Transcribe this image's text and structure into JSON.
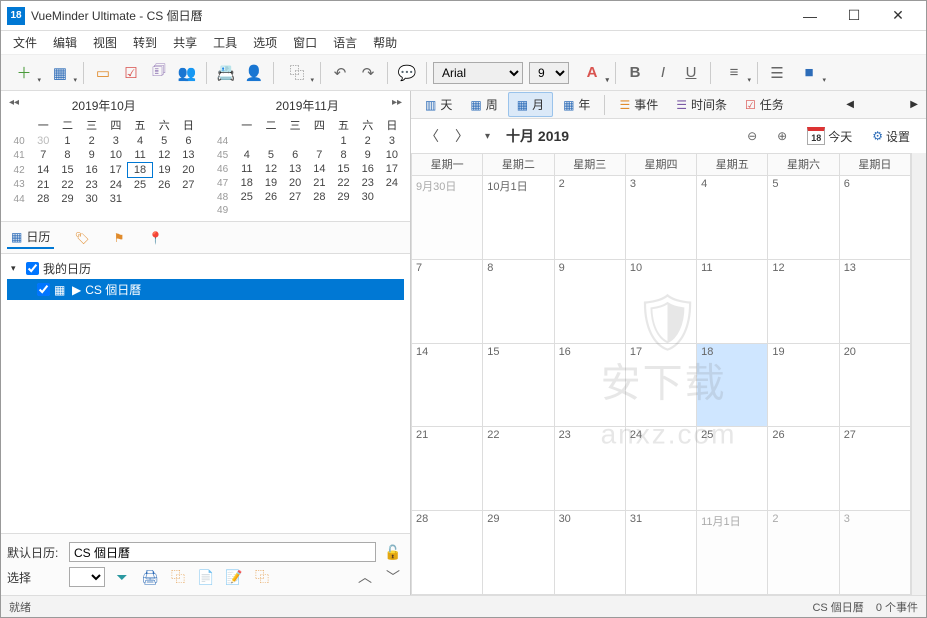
{
  "window": {
    "icon_text": "18",
    "title": "VueMinder Ultimate - CS 個日曆"
  },
  "menu": [
    "文件",
    "编辑",
    "视图",
    "转到",
    "共享",
    "工具",
    "选项",
    "窗口",
    "语言",
    "帮助"
  ],
  "toolbar": {
    "font_name": "Arial",
    "font_size": "9"
  },
  "mini_cals": [
    {
      "title": "2019年10月",
      "dow": [
        "",
        "一",
        "二",
        "三",
        "四",
        "五",
        "六",
        "日"
      ],
      "rows": [
        [
          "40",
          "30",
          "1",
          "2",
          "3",
          "4",
          "5",
          "6"
        ],
        [
          "41",
          "7",
          "8",
          "9",
          "10",
          "11",
          "12",
          "13"
        ],
        [
          "42",
          "14",
          "15",
          "16",
          "17",
          "18",
          "19",
          "20"
        ],
        [
          "43",
          "21",
          "22",
          "23",
          "24",
          "25",
          "26",
          "27"
        ],
        [
          "44",
          "28",
          "29",
          "30",
          "31",
          "",
          "",
          ""
        ]
      ],
      "today_col": 5,
      "today_row": 2,
      "dim_first": true
    },
    {
      "title": "2019年11月",
      "dow": [
        "",
        "一",
        "二",
        "三",
        "四",
        "五",
        "六",
        "日"
      ],
      "rows": [
        [
          "44",
          "",
          "",
          "",
          "",
          "1",
          "2",
          "3"
        ],
        [
          "45",
          "4",
          "5",
          "6",
          "7",
          "8",
          "9",
          "10"
        ],
        [
          "46",
          "11",
          "12",
          "13",
          "14",
          "15",
          "16",
          "17"
        ],
        [
          "47",
          "18",
          "19",
          "20",
          "21",
          "22",
          "23",
          "24"
        ],
        [
          "48",
          "25",
          "26",
          "27",
          "28",
          "29",
          "30",
          ""
        ],
        [
          "49",
          "",
          "",
          "",
          "",
          "",
          "",
          ""
        ]
      ]
    }
  ],
  "tree_tabs": {
    "calendar": "日历"
  },
  "tree": {
    "root": "我的日历",
    "child": "CS 個日曆"
  },
  "left_bottom": {
    "default_label": "默认日历:",
    "default_value": "CS 個日曆",
    "select_label": "选择"
  },
  "view_tabs": {
    "day": "天",
    "week": "周",
    "month": "月",
    "year": "年",
    "event": "事件",
    "timeline": "时间条",
    "task": "任务"
  },
  "cal_header": {
    "title": "十月 2019",
    "today": "今天",
    "today_num": "18",
    "settings": "设置"
  },
  "dow": [
    "星期一",
    "星期二",
    "星期三",
    "星期四",
    "星期五",
    "星期六",
    "星期日"
  ],
  "month_cells": [
    [
      {
        "t": "9月30日",
        "o": true
      },
      {
        "t": "10月1日"
      },
      {
        "t": "2"
      },
      {
        "t": "3"
      },
      {
        "t": "4"
      },
      {
        "t": "5"
      },
      {
        "t": "6"
      }
    ],
    [
      {
        "t": "7"
      },
      {
        "t": "8"
      },
      {
        "t": "9"
      },
      {
        "t": "10"
      },
      {
        "t": "11"
      },
      {
        "t": "12"
      },
      {
        "t": "13"
      }
    ],
    [
      {
        "t": "14"
      },
      {
        "t": "15"
      },
      {
        "t": "16"
      },
      {
        "t": "17"
      },
      {
        "t": "18",
        "today": true
      },
      {
        "t": "19"
      },
      {
        "t": "20"
      }
    ],
    [
      {
        "t": "21"
      },
      {
        "t": "22"
      },
      {
        "t": "23"
      },
      {
        "t": "24"
      },
      {
        "t": "25"
      },
      {
        "t": "26"
      },
      {
        "t": "27"
      }
    ],
    [
      {
        "t": "28"
      },
      {
        "t": "29"
      },
      {
        "t": "30"
      },
      {
        "t": "31"
      },
      {
        "t": "11月1日",
        "o": true
      },
      {
        "t": "2",
        "o": true
      },
      {
        "t": "3",
        "o": true
      }
    ]
  ],
  "status": {
    "left": "就绪",
    "right_cal": "CS 個日曆",
    "right_count": "0 个事件"
  },
  "watermark": {
    "top": "安下载",
    "bottom": "anxz.com"
  }
}
